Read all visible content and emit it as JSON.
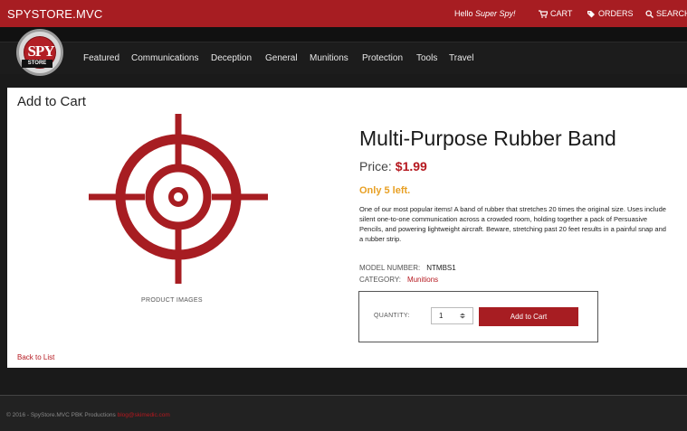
{
  "header": {
    "brand": "SPYSTORE.MVC",
    "greeting_prefix": "Hello ",
    "greeting_name": "Super Spy!",
    "cart_label": "CART",
    "orders_label": "ORDERS",
    "search_label": "SEARCH"
  },
  "logo": {
    "top": "SPY",
    "bottom": "STORE"
  },
  "nav": {
    "items": [
      "Featured",
      "Communications",
      "Deception",
      "General",
      "Munitions",
      "Protection",
      "Tools",
      "Travel"
    ]
  },
  "page": {
    "title": "Add to Cart",
    "product_images_label": "PRODUCT IMAGES",
    "back_link": "Back to List"
  },
  "product": {
    "name": "Multi-Purpose Rubber Band",
    "price_label": "Price:",
    "price": "$1.99",
    "stock": "Only 5 left.",
    "description": "One of our most popular items! A band of rubber that stretches 20 times the original size. Uses include silent one-to-one communication across a crowded room, holding together a pack of Persuasive Pencils, and powering lightweight aircraft. Beware, stretching past 20 feet results in a painful snap and a rubber strip.",
    "model_label": "MODEL NUMBER:",
    "model_value": "NTMBS1",
    "category_label": "CATEGORY:",
    "category_value": "Munitions"
  },
  "cart": {
    "quantity_label": "QUANTITY:",
    "quantity_value": "1",
    "add_button": "Add to Cart"
  },
  "footer": {
    "text": "© 2016 - SpyStore.MVC PBK Productions",
    "link": "blog@skimedic.com"
  },
  "colors": {
    "brand_red": "#a71d22",
    "stock_orange": "#e8a024",
    "dark_bg": "#1a1a1a"
  },
  "icons": [
    "cart-icon",
    "tag-icon",
    "search-icon",
    "crosshair-target-icon",
    "spinner-icon"
  ]
}
